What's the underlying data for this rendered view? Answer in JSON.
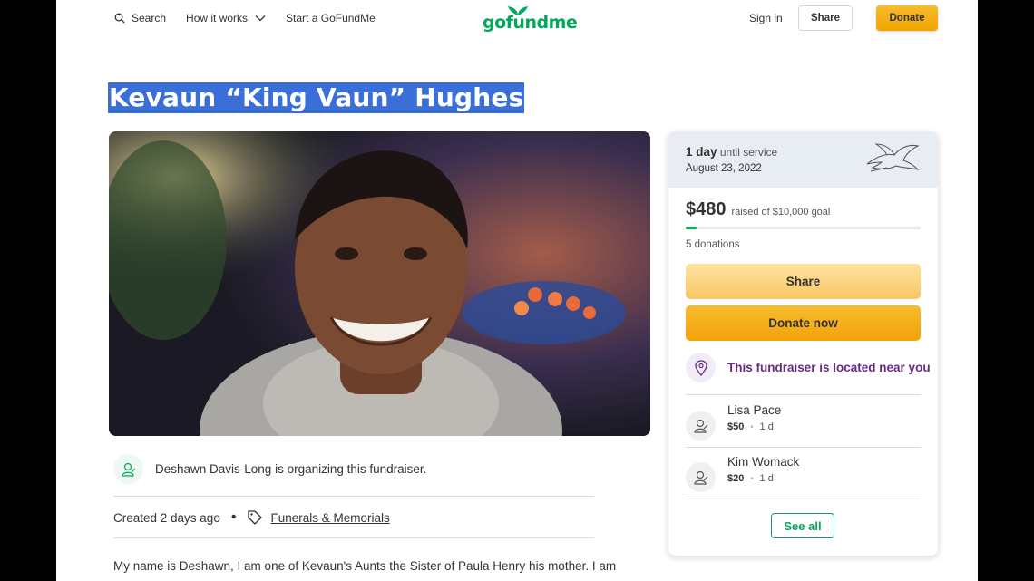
{
  "header": {
    "search_label": "Search",
    "how_it_works_label": "How it works",
    "start_label": "Start a GoFundMe",
    "logo_text": "gofundme",
    "signin_label": "Sign in",
    "share_label": "Share",
    "donate_label": "Donate"
  },
  "title": "Kevaun “King Vaun” Hughes",
  "organizer": {
    "text": "Deshawn Davis-Long is organizing this fundraiser."
  },
  "meta": {
    "created": "Created 2 days ago",
    "dot": "•",
    "category": "Funerals & Memorials"
  },
  "story": "My name is Deshawn, I am one of Kevaun's Aunts the Sister of Paula Henry his mother. I am",
  "card": {
    "days_count": "1 day",
    "days_suffix": "until service",
    "date": "August 23, 2022",
    "raised": "$480",
    "goal_text": "raised of $10,000 goal",
    "progress_fraction": 0.048,
    "donations": "5 donations",
    "share_label": "Share",
    "donate_label": "Donate now",
    "near_text": "This fundraiser is located near you",
    "donors": [
      {
        "name": "Lisa Pace",
        "amount": "$50",
        "sep": "•",
        "time": "1 d"
      },
      {
        "name": "Kim Womack",
        "amount": "$20",
        "sep": "•",
        "time": "1 d"
      }
    ],
    "see_all_label": "See all"
  },
  "colors": {
    "brand_green": "#02a95c",
    "donate_yellow": "#f2a20a",
    "title_highlight": "#3a6fd8",
    "near_purple": "#6a2a82"
  }
}
